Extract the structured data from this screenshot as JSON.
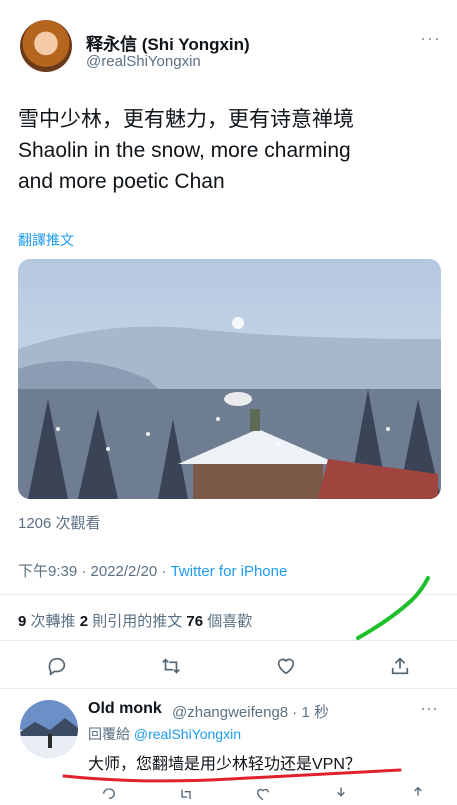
{
  "tweet": {
    "display_name": "释永信 (Shi Yongxin)",
    "handle": "@realShiYongxin",
    "more": "···",
    "text_zh": "雪中少林，更有魅力，更有诗意禅境",
    "text_en_1": "Shaolin in the snow, more charming",
    "text_en_2": "and more poetic Chan",
    "translate_label": "翻譯推文",
    "views": "1206 次觀看",
    "time": "下午9:39 · 2022/2/20 · ",
    "source": "Twitter for iPhone",
    "retweets_count": "9",
    "retweets_label": " 次轉推  ",
    "quotes_count": "2",
    "quotes_label": " 則引用的推文  ",
    "likes_count": "76",
    "likes_label": " 個喜歡"
  },
  "reply": {
    "display_name": "Old monk",
    "handle": "@zhangweifeng8 · 1 秒",
    "more": "···",
    "replying_prefix": "回覆給 ",
    "replying_to": "@realShiYongxin",
    "text": "大师，您翻墙是用少林轻功还是VPN？"
  },
  "icons": [
    "comment-icon",
    "retweet-icon",
    "heart-icon",
    "share-icon"
  ],
  "colors": {
    "link": "#1d9bf0",
    "muted": "#5b7083",
    "annotation_green": "#1dbf2a",
    "annotation_red": "#e0202a"
  }
}
